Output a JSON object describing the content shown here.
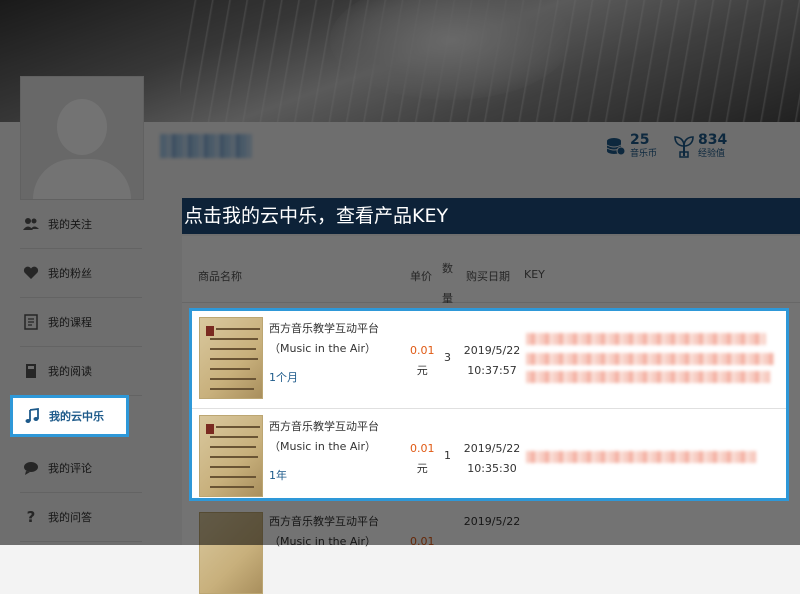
{
  "stats": [
    {
      "value": "25",
      "label": "音乐币",
      "icon": "coins-icon"
    },
    {
      "value": "834",
      "label": "经验值",
      "icon": "sprout-icon"
    }
  ],
  "sidebar": {
    "items": [
      {
        "label": "我的关注",
        "icon": "users-icon"
      },
      {
        "label": "我的粉丝",
        "icon": "heart-icon"
      },
      {
        "label": "我的课程",
        "icon": "document-icon"
      },
      {
        "label": "我的阅读",
        "icon": "book-icon"
      },
      {
        "label": "我的云中乐",
        "icon": "music-note-icon",
        "active": true
      },
      {
        "label": "我的评论",
        "icon": "comment-icon"
      },
      {
        "label": "我的问答",
        "icon": "question-icon"
      }
    ]
  },
  "annotation": {
    "text": "点击我的云中乐，查看产品KEY"
  },
  "table": {
    "headers": {
      "name": "商品名称",
      "price": "单价",
      "qty": "数量",
      "date": "购买日期",
      "key": "KEY"
    },
    "rows": [
      {
        "name_line1": "西方音乐教学互动平台",
        "name_line2": "（Music in the Air）",
        "duration": "1个月",
        "price": "0.01",
        "currency": "元",
        "qty": "3",
        "date": "2019/5/22",
        "time": "10:37:57"
      },
      {
        "name_line1": "西方音乐教学互动平台",
        "name_line2": "（Music in the Air）",
        "duration": "1年",
        "price": "0.01",
        "currency": "元",
        "qty": "1",
        "date": "2019/5/22",
        "time": "10:35:30"
      },
      {
        "name_line1": "西方音乐教学互动平台",
        "name_line2": "（Music in the Air）",
        "price": "0.01",
        "date": "2019/5/22"
      }
    ]
  },
  "colors": {
    "accent": "#2e98d8",
    "link": "#1d5a8a",
    "price": "#e05a14",
    "annotation_bg": "#0d2238"
  }
}
